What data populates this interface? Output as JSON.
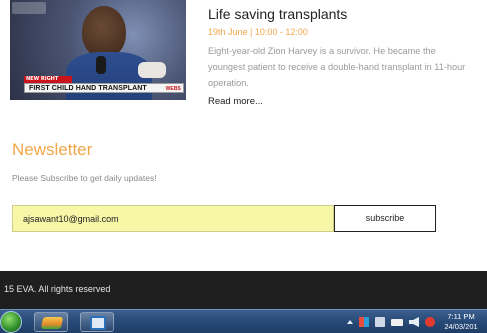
{
  "news": {
    "title": "Life saving transplants",
    "date": "19th June | 10:00 - 12:00",
    "body": "Eight-year-old Zion Harvey is a survivor. He became the youngest patient to receive a double-hand transplant in 11-hour operation.",
    "read_more": "Read more...",
    "thumbnail": {
      "headline": "FIRST CHILD HAND TRANSPLANT",
      "breaking": "NEW RIGHT NOW",
      "tag": "WEBS"
    }
  },
  "newsletter": {
    "title": "Newsletter",
    "subtitle": "Please Subscribe to get daily updates!",
    "email_value": "ajsawant10@gmail.com",
    "subscribe_label": "subscribe"
  },
  "footer": {
    "copyright": "15 EVA. All rights reserved"
  },
  "taskbar": {
    "time": "7:11 PM",
    "date": "24/03/201"
  },
  "colors": {
    "accent": "#f0a74a",
    "input_bg": "#f7f7a8",
    "footer_bg": "#1f1f1f"
  }
}
